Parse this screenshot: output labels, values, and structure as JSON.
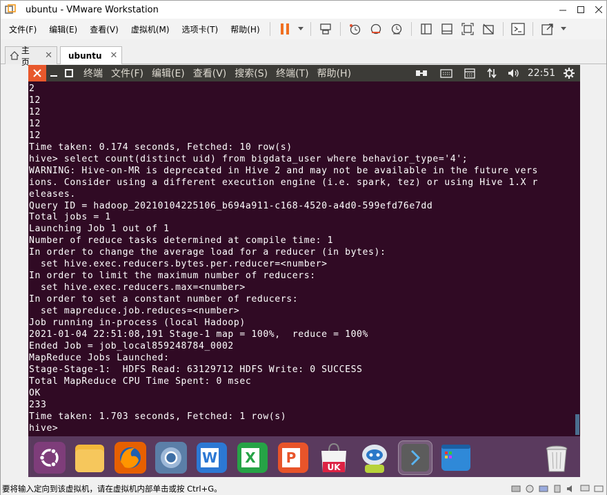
{
  "window": {
    "title": "ubuntu - VMware Workstation"
  },
  "menu": {
    "items": [
      "文件(F)",
      "编辑(E)",
      "查看(V)",
      "虚拟机(M)",
      "选项卡(T)",
      "帮助(H)"
    ]
  },
  "tabs": [
    {
      "label": "主页",
      "active": false
    },
    {
      "label": "ubuntu",
      "active": true
    }
  ],
  "vm_topbar": {
    "menus": [
      "终端",
      "文件(F)",
      "编辑(E)",
      "查看(V)",
      "搜索(S)",
      "终端(T)",
      "帮助(H)"
    ],
    "clock": "22:51"
  },
  "terminal": {
    "lines": [
      "2",
      "12",
      "12",
      "12",
      "12",
      "Time taken: 0.174 seconds, Fetched: 10 row(s)",
      "hive> select count(distinct uid) from bigdata_user where behavior_type='4';",
      "WARNING: Hive-on-MR is deprecated in Hive 2 and may not be available in the future vers",
      "ions. Consider using a different execution engine (i.e. spark, tez) or using Hive 1.X r",
      "eleases.",
      "Query ID = hadoop_20210104225106_b694a911-c168-4520-a4d0-599efd76e7dd",
      "Total jobs = 1",
      "Launching Job 1 out of 1",
      "Number of reduce tasks determined at compile time: 1",
      "In order to change the average load for a reducer (in bytes):",
      "  set hive.exec.reducers.bytes.per.reducer=<number>",
      "In order to limit the maximum number of reducers:",
      "  set hive.exec.reducers.max=<number>",
      "In order to set a constant number of reducers:",
      "  set mapreduce.job.reduces=<number>",
      "Job running in-process (local Hadoop)",
      "2021-01-04 22:51:08,191 Stage-1 map = 100%,  reduce = 100%",
      "Ended Job = job_local859248784_0002",
      "MapReduce Jobs Launched:",
      "Stage-Stage-1:  HDFS Read: 63129712 HDFS Write: 0 SUCCESS",
      "Total MapReduce CPU Time Spent: 0 msec",
      "OK",
      "233",
      "Time taken: 1.703 seconds, Fetched: 1 row(s)",
      "hive> "
    ]
  },
  "dock": {
    "items": [
      {
        "name": "ubuntu-logo-icon"
      },
      {
        "name": "files-icon"
      },
      {
        "name": "firefox-icon"
      },
      {
        "name": "chromium-icon"
      },
      {
        "name": "wps-writer-icon",
        "text": "W"
      },
      {
        "name": "wps-spreadsheet-icon",
        "text": "X"
      },
      {
        "name": "wps-presentation-icon",
        "text": "P"
      },
      {
        "name": "ubuntu-software-icon",
        "text": "UK"
      },
      {
        "name": "robot-icon"
      },
      {
        "name": "terminal-icon"
      },
      {
        "name": "workspace-icon"
      },
      {
        "name": "trash-icon"
      }
    ]
  },
  "status": {
    "text": "要将输入定向到该虚拟机，请在虚拟机内部单击或按 Ctrl+G。"
  },
  "colors": {
    "terminal_bg": "#300a24",
    "topbar_bg": "#3c3b37",
    "close_btn": "#e8582c",
    "dock_bg": "#5a3a5e"
  }
}
